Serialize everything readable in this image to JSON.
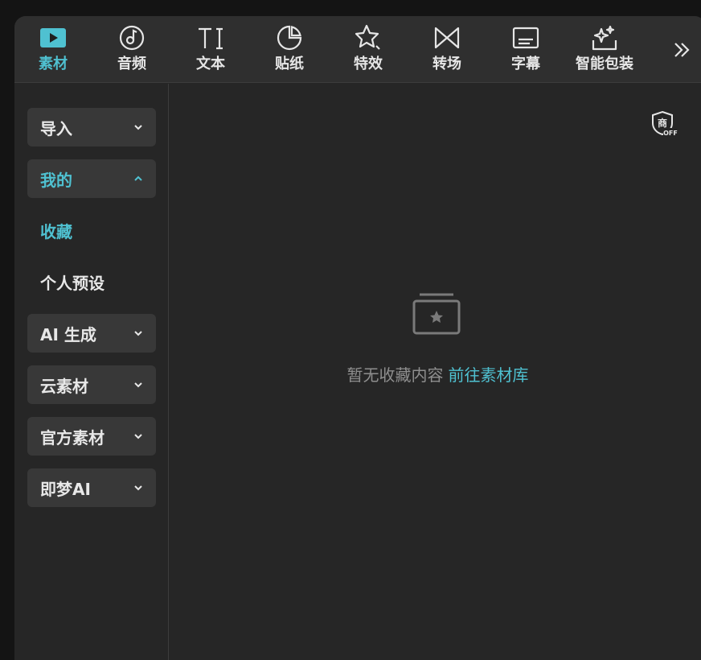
{
  "toolbar": {
    "tabs": [
      {
        "label": "素材",
        "icon": "media-play-icon",
        "active": true
      },
      {
        "label": "音频",
        "icon": "music-note-icon"
      },
      {
        "label": "文本",
        "icon": "text-icon"
      },
      {
        "label": "贴纸",
        "icon": "sticker-icon"
      },
      {
        "label": "特效",
        "icon": "effects-star-icon"
      },
      {
        "label": "转场",
        "icon": "transition-icon"
      },
      {
        "label": "字幕",
        "icon": "subtitle-icon"
      },
      {
        "label": "智能包装",
        "icon": "smart-package-icon"
      }
    ],
    "more_icon": "double-chevron-right-icon"
  },
  "sidebar": {
    "items": [
      {
        "label": "导入",
        "expandable": true,
        "expanded": false
      },
      {
        "label": "我的",
        "expandable": true,
        "expanded": true,
        "active": true
      },
      {
        "label": "收藏",
        "active": true
      },
      {
        "label": "个人预设"
      },
      {
        "label": "AI 生成",
        "expandable": true,
        "expanded": false
      },
      {
        "label": "云素材",
        "expandable": true,
        "expanded": false
      },
      {
        "label": "官方素材",
        "expandable": true,
        "expanded": false
      },
      {
        "label": "即梦AI",
        "expandable": true,
        "expanded": false
      }
    ]
  },
  "content": {
    "commercial_badge_text": "商",
    "commercial_badge_state": "OFF",
    "empty_message": "暂无收藏内容",
    "empty_link": "前往素材库"
  },
  "colors": {
    "accent": "#4fc1d1",
    "panel_bg": "#262626",
    "toolbar_bg": "#2f2f2f",
    "item_bg": "#383838"
  }
}
